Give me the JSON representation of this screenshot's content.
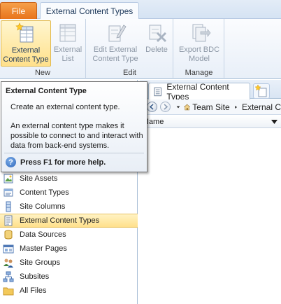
{
  "tabs": {
    "file": "File",
    "active": "External Content Types"
  },
  "ribbon": {
    "groups": [
      {
        "label": "New"
      },
      {
        "label": "Edit"
      },
      {
        "label": "Manage"
      }
    ],
    "buttons": {
      "external_content_type": "External Content Type",
      "external_list": "External List",
      "edit_external_content_type": "Edit External Content Type",
      "delete": "Delete",
      "export_bdc_model": "Export BDC Model"
    }
  },
  "tooltip": {
    "title": "External Content Type",
    "description": "Create an external content type.",
    "body": "An external content type makes it possible to connect to and interact with data from back-end systems.",
    "help": "Press F1 for more help."
  },
  "navigation": {
    "items": [
      {
        "label": "Site Assets",
        "icon": "site-assets-icon"
      },
      {
        "label": "Content Types",
        "icon": "content-types-icon"
      },
      {
        "label": "Site Columns",
        "icon": "site-columns-icon"
      },
      {
        "label": "External Content Types",
        "icon": "external-content-types-icon",
        "selected": true
      },
      {
        "label": "Data Sources",
        "icon": "data-sources-icon"
      },
      {
        "label": "Master Pages",
        "icon": "master-pages-icon"
      },
      {
        "label": "Site Groups",
        "icon": "site-groups-icon"
      },
      {
        "label": "Subsites",
        "icon": "subsites-icon"
      },
      {
        "label": "All Files",
        "icon": "folder-icon"
      }
    ]
  },
  "document": {
    "tab_label": "External Content Types",
    "breadcrumb": [
      "Team Site",
      "External C"
    ],
    "column_header": "Name"
  },
  "colors": {
    "file_tab": "#e8741c",
    "selection": "#ffe08b",
    "ribbon_text": "#1e395b"
  }
}
